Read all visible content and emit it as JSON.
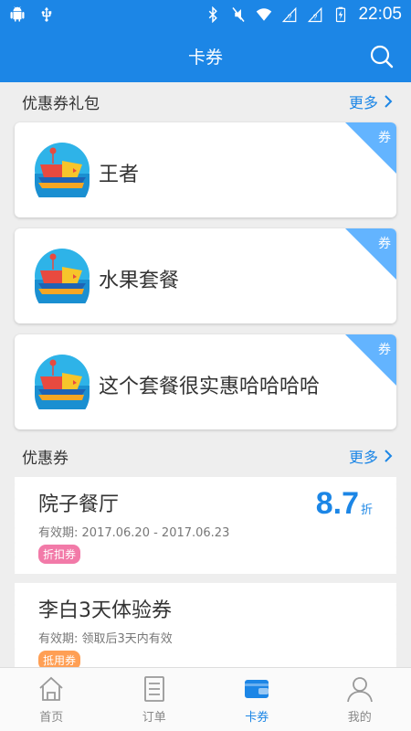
{
  "status_bar": {
    "time": "22:05",
    "left_icons": [
      "android-icon",
      "usb-icon"
    ],
    "right_icons": [
      "bluetooth-icon",
      "mute-icon",
      "wifi-icon",
      "signal-icon",
      "signal-icon",
      "battery-icon"
    ]
  },
  "header": {
    "title": "卡券",
    "search_icon": "search-icon"
  },
  "packages": {
    "title": "优惠券礼包",
    "more_label": "更多",
    "tag_label": "券",
    "items": [
      {
        "name": "王者"
      },
      {
        "name": "水果套餐"
      },
      {
        "name": "这个套餐很实惠哈哈哈哈"
      }
    ]
  },
  "coupons": {
    "title": "优惠券",
    "more_label": "更多",
    "items": [
      {
        "name": "院子餐厅",
        "validity_label": "有效期:",
        "validity_value": "2017.06.20 - 2017.06.23",
        "badge": "折扣券",
        "discount_value": "8.7",
        "discount_unit": "折"
      },
      {
        "name": "李白3天体验券",
        "validity_label": "有效期:",
        "validity_value": "领取后3天内有效",
        "badge": "抵用券"
      }
    ]
  },
  "tabs": [
    {
      "label": "首页",
      "icon": "home-icon"
    },
    {
      "label": "订单",
      "icon": "order-icon"
    },
    {
      "label": "卡券",
      "icon": "wallet-icon",
      "active": true
    },
    {
      "label": "我的",
      "icon": "user-icon"
    }
  ],
  "colors": {
    "primary": "#1c86e6",
    "corner_tag": "#63b4ff",
    "discount_badge": "#f27aa8",
    "voucher_badge": "#ff9f54",
    "background": "#eeeeee"
  }
}
